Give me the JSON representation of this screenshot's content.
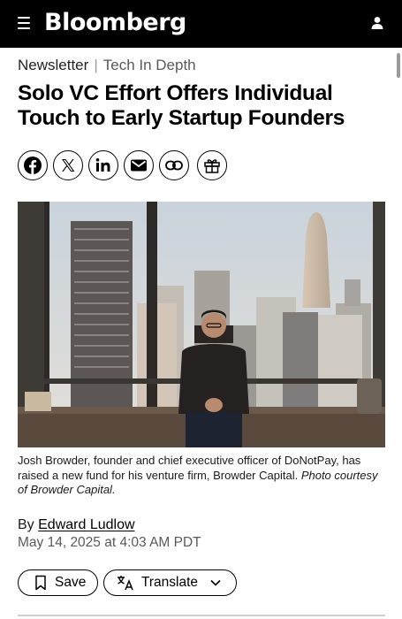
{
  "header": {
    "brand": "Bloomberg"
  },
  "kicker": {
    "primary": "Newsletter",
    "separator": "|",
    "secondary": "Tech In Depth"
  },
  "article": {
    "headline_line1": "Solo VC Effort Offers Individual",
    "headline_line2": "Touch to Early Startup Founders",
    "caption_text": "Josh Browder, founder and chief executive officer of DoNotPay, has raised a new fund for his venture firm, Browder Capital. ",
    "caption_credit": "Photo courtesy of Browder Capital.",
    "byline_prefix": "By ",
    "author": "Edward Ludlow",
    "date": "May 14, 2025 at 4:03 AM PDT"
  },
  "share": {
    "icons": [
      "facebook-icon",
      "x-icon",
      "linkedin-icon",
      "email-icon",
      "link-icon",
      "gift-icon"
    ]
  },
  "actions": {
    "save_label": "Save",
    "translate_label": "Translate"
  },
  "colors": {
    "header_bg": "#000000",
    "text": "#000000",
    "muted": "#5a5a5a"
  }
}
